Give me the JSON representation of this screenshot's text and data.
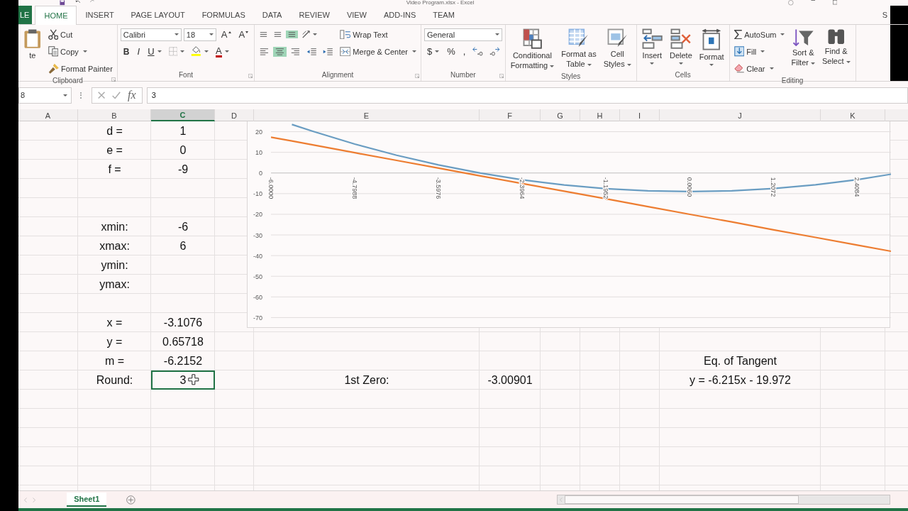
{
  "window": {
    "title": "Video Program.xlsx - Excel"
  },
  "ribbon_tabs": [
    {
      "label": "LE",
      "kind": "file",
      "selected": false
    },
    {
      "label": "HOME",
      "kind": "tab",
      "selected": true
    },
    {
      "label": "INSERT",
      "kind": "tab",
      "selected": false
    },
    {
      "label": "PAGE LAYOUT",
      "kind": "tab",
      "selected": false
    },
    {
      "label": "FORMULAS",
      "kind": "tab",
      "selected": false
    },
    {
      "label": "DATA",
      "kind": "tab",
      "selected": false
    },
    {
      "label": "REVIEW",
      "kind": "tab",
      "selected": false
    },
    {
      "label": "VIEW",
      "kind": "tab",
      "selected": false
    },
    {
      "label": "ADD-INS",
      "kind": "tab",
      "selected": false
    },
    {
      "label": "TEAM",
      "kind": "tab",
      "selected": false
    }
  ],
  "account": {
    "label": "S"
  },
  "ribbon_groups": [
    {
      "label": "Clipboard",
      "launcher": true,
      "blocks": [
        {
          "kind": "large",
          "label": "te"
        },
        {
          "kind": "stack",
          "lines": [
            [
              {
                "kind": "small",
                "label": "Cut"
              }
            ],
            [
              {
                "kind": "small",
                "label": "Copy",
                "dropdown": true
              }
            ],
            [
              {
                "kind": "small",
                "label": "Format Painter"
              }
            ]
          ]
        }
      ]
    },
    {
      "label": "Font",
      "launcher": true,
      "blocks": [
        {
          "kind": "stack",
          "lines": [
            [
              {
                "kind": "combo",
                "label": "Calibri"
              },
              {
                "kind": "combo",
                "label": "18"
              },
              {
                "kind": "grow",
                "label": "A"
              },
              {
                "kind": "shrink",
                "label": "A"
              }
            ],
            [
              {
                "kind": "bold",
                "label": "B"
              },
              {
                "kind": "italic",
                "label": "I"
              },
              {
                "kind": "underline",
                "label": "U",
                "dropdown": true
              },
              {
                "kind": "icon",
                "dropdown": true
              },
              {
                "kind": "icon",
                "dropdown": true
              },
              {
                "kind": "fontcolor",
                "label": "A",
                "dropdown": true
              }
            ]
          ]
        }
      ]
    },
    {
      "label": "Alignment",
      "launcher": true,
      "blocks": [
        {
          "kind": "stack",
          "lines": [
            [
              {
                "kind": "icon",
                "selected": false
              },
              {
                "kind": "icon",
                "selected": false
              },
              {
                "kind": "icon",
                "selected": true
              },
              {
                "kind": "icon",
                "dropdown": true
              }
            ],
            [
              {
                "kind": "icon",
                "selected": false
              },
              {
                "kind": "icon",
                "selected": true
              },
              {
                "kind": "icon",
                "selected": false
              },
              {
                "kind": "icon"
              },
              {
                "kind": "icon"
              }
            ]
          ]
        },
        {
          "kind": "stack",
          "lines": [
            [
              {
                "kind": "small",
                "label": "Wrap Text"
              }
            ],
            [
              {
                "kind": "small",
                "label": "Merge & Center",
                "dropdown": true
              }
            ]
          ]
        }
      ]
    },
    {
      "label": "Number",
      "launcher": true,
      "blocks": [
        {
          "kind": "stack",
          "lines": [
            [
              {
                "kind": "combo",
                "label": "General"
              }
            ],
            [
              {
                "kind": "text",
                "label": "$",
                "dropdown": true
              },
              {
                "kind": "text",
                "label": "%"
              },
              {
                "kind": "text",
                "label": ","
              },
              {
                "kind": "icon"
              },
              {
                "kind": "icon"
              }
            ]
          ]
        }
      ]
    },
    {
      "label": "Styles",
      "blocks": [
        {
          "kind": "large",
          "label": "Conditional\nFormatting",
          "dropdown": true
        },
        {
          "kind": "large",
          "label": "Format as\nTable",
          "dropdown": true
        },
        {
          "kind": "large",
          "label": "Cell\nStyles",
          "dropdown": true
        }
      ]
    },
    {
      "label": "Cells",
      "blocks": [
        {
          "kind": "large",
          "label": "Insert",
          "dropdown": true,
          "caret_below": true
        },
        {
          "kind": "large",
          "label": "Delete",
          "dropdown": true,
          "caret_below": true
        },
        {
          "kind": "large",
          "label": "Format",
          "dropdown": true,
          "caret_below": true
        }
      ]
    },
    {
      "label": "Editing",
      "blocks": [
        {
          "kind": "stack",
          "lines": [
            [
              {
                "kind": "small",
                "label": "AutoSum",
                "dropdown": true
              }
            ],
            [
              {
                "kind": "small",
                "label": "Fill",
                "dropdown": true
              }
            ],
            [
              {
                "kind": "small",
                "label": "Clear",
                "dropdown": true
              }
            ]
          ]
        },
        {
          "kind": "large",
          "label": "Sort &\nFilter",
          "dropdown": true
        },
        {
          "kind": "large",
          "label": "Find &\nSelect",
          "dropdown": true
        }
      ]
    }
  ],
  "formula_bar": {
    "name_box": "8",
    "function_label": "fx",
    "value": "3"
  },
  "sheet": {
    "columns": [
      {
        "label": "A",
        "selected": false
      },
      {
        "label": "B",
        "selected": false
      },
      {
        "label": "C",
        "selected": true
      },
      {
        "label": "D",
        "selected": false
      },
      {
        "label": "E",
        "selected": false
      },
      {
        "label": "F",
        "selected": false
      },
      {
        "label": "G",
        "selected": false
      },
      {
        "label": "H",
        "selected": false
      },
      {
        "label": "I",
        "selected": false
      },
      {
        "label": "J",
        "selected": false
      },
      {
        "label": "K",
        "selected": false
      }
    ],
    "rows": [
      {
        "cells": [
          "",
          {
            "text": "d =",
            "selected": false
          },
          {
            "text": "1",
            "selected": false
          }
        ]
      },
      {
        "cells": [
          "",
          {
            "text": "e =",
            "selected": false
          },
          {
            "text": "0",
            "selected": false
          }
        ]
      },
      {
        "cells": [
          "",
          {
            "text": "f =",
            "selected": false
          },
          {
            "text": "-9",
            "selected": false
          }
        ]
      },
      {},
      {},
      {
        "cells": [
          "",
          {
            "text": "xmin:",
            "selected": false
          },
          {
            "text": "-6",
            "selected": false
          }
        ]
      },
      {
        "cells": [
          "",
          {
            "text": "xmax:",
            "selected": false
          },
          {
            "text": "6",
            "selected": false
          }
        ]
      },
      {
        "cells": [
          "",
          {
            "text": "ymin:",
            "selected": false
          }
        ]
      },
      {
        "cells": [
          "",
          {
            "text": "ymax:",
            "selected": false
          }
        ]
      },
      {},
      {
        "cells": [
          "",
          {
            "text": "x =",
            "selected": false
          },
          {
            "text": "-3.1076",
            "selected": false
          }
        ]
      },
      {
        "cells": [
          "",
          {
            "text": "y =",
            "selected": false
          },
          {
            "text": "0.65718",
            "selected": false
          }
        ]
      },
      {
        "cells": [
          "",
          {
            "text": "m =",
            "selected": false
          },
          {
            "text": "-6.2152",
            "selected": false
          },
          "",
          "",
          "",
          "",
          "",
          "",
          {
            "text": "Eq. of Tangent",
            "selected": false
          }
        ]
      },
      {
        "cells": [
          "",
          {
            "text": "Round:",
            "selected": false
          },
          {
            "text": "3",
            "selected": true
          },
          "",
          {
            "text": "1st Zero:",
            "selected": false
          },
          {
            "text": "-3.00901",
            "selected": false
          },
          "",
          "",
          "",
          {
            "text": "y = -6.215x - 19.972",
            "selected": false
          }
        ]
      },
      {},
      {},
      {},
      {},
      {}
    ],
    "chart_data": {
      "type": "line",
      "grid": true,
      "x": [
        -6,
        -5.7,
        -5.3994,
        -4.7988,
        -4.1982,
        -3.5976,
        -2.997,
        -2.3964,
        -1.7958,
        -1.1952,
        -0.5946,
        0.006,
        0.6066,
        1.2072,
        1.8078,
        2.4084,
        2.89
      ],
      "series": [
        {
          "color": "#6a9dc2",
          "values": [
            null,
            23.5,
            20.2,
            14,
            8.6,
            3.9,
            0,
            -3.3,
            -5.8,
            -7.6,
            -8.6,
            -9,
            -8.6,
            -7.5,
            -5.7,
            -3.2,
            -0.6
          ]
        },
        {
          "color": "#ed7d31",
          "values": [
            17.3,
            15.5,
            13.6,
            9.8,
            6.1,
            2.4,
            -1.4,
            -5.1,
            -8.8,
            -12.5,
            -16.3,
            -20,
            -23.7,
            -27.5,
            -31.2,
            -34.9,
            -37.9
          ]
        }
      ],
      "xlim": [
        -6,
        2.89
      ],
      "ylim": [
        -75,
        25
      ],
      "yticks": [
        20,
        10,
        0,
        -10,
        -20,
        -30,
        -40,
        -50,
        -60,
        -70
      ],
      "xticks": [
        {
          "value": -6,
          "label": "-6.0000"
        },
        {
          "value": -4.7988,
          "label": "-4.7988"
        },
        {
          "value": -3.5976,
          "label": "-3.5976"
        },
        {
          "value": -2.3964,
          "label": "-2.3964"
        },
        {
          "value": -1.1952,
          "label": "-1.1952"
        },
        {
          "value": 0.006,
          "label": "0.0060"
        },
        {
          "value": 1.2072,
          "label": "1.2072"
        },
        {
          "value": 2.4084,
          "label": "2.4084"
        }
      ]
    }
  },
  "sheet_tabs": [
    {
      "label": "Sheet1",
      "selected": true
    }
  ]
}
